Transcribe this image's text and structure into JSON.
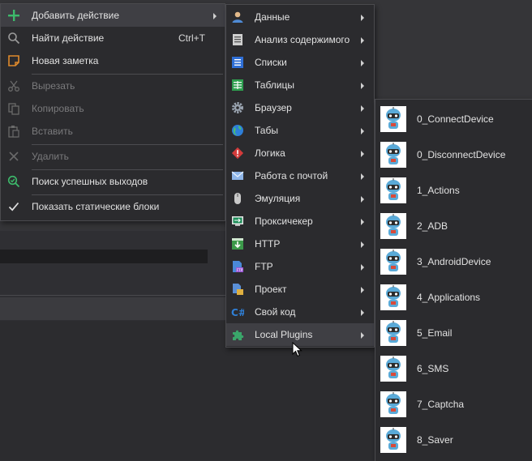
{
  "context_menu": {
    "items": [
      {
        "label": "Добавить действие",
        "icon": "plus-icon",
        "submenu": true,
        "highlighted": true
      },
      {
        "label": "Найти действие",
        "icon": "search-icon",
        "shortcut": "Ctrl+T"
      },
      {
        "label": "Новая заметка",
        "icon": "note-icon"
      },
      {
        "label": "Вырезать",
        "icon": "scissors-icon",
        "disabled": true
      },
      {
        "label": "Копировать",
        "icon": "copy-icon",
        "disabled": true
      },
      {
        "label": "Вставить",
        "icon": "paste-icon",
        "disabled": true
      },
      {
        "label": "Удалить",
        "icon": "delete-icon",
        "disabled": true
      },
      {
        "label": "Поиск успешных выходов",
        "icon": "search-success-icon"
      },
      {
        "label": "Показать статические блоки",
        "icon": "checkmark-icon"
      }
    ]
  },
  "actions_submenu": {
    "items": [
      {
        "label": "Данные",
        "icon": "user-data-icon"
      },
      {
        "label": "Анализ содержимого",
        "icon": "document-analysis-icon"
      },
      {
        "label": "Списки",
        "icon": "list-icon"
      },
      {
        "label": "Таблицы",
        "icon": "table-icon"
      },
      {
        "label": "Браузер",
        "icon": "browser-gear-icon"
      },
      {
        "label": "Табы",
        "icon": "globe-icon"
      },
      {
        "label": "Логика",
        "icon": "logic-icon"
      },
      {
        "label": "Работа с почтой",
        "icon": "mail-icon"
      },
      {
        "label": "Эмуляция",
        "icon": "mouse-icon"
      },
      {
        "label": "Проксичекер",
        "icon": "proxy-checker-icon"
      },
      {
        "label": "HTTP",
        "icon": "http-download-icon"
      },
      {
        "label": "FTP",
        "icon": "ftp-icon"
      },
      {
        "label": "Проект",
        "icon": "project-icon"
      },
      {
        "label": "Свой код",
        "icon": "csharp-icon"
      },
      {
        "label": "Local Plugins",
        "icon": "puzzle-icon",
        "highlighted": true
      }
    ]
  },
  "plugins_submenu": {
    "items": [
      {
        "label": "0_ConnectDevice",
        "icon": "robot-icon"
      },
      {
        "label": "0_DisconnectDevice",
        "icon": "robot-icon"
      },
      {
        "label": "1_Actions",
        "icon": "robot-icon"
      },
      {
        "label": "2_ADB",
        "icon": "robot-icon"
      },
      {
        "label": "3_AndroidDevice",
        "icon": "robot-icon"
      },
      {
        "label": "4_Applications",
        "icon": "robot-icon"
      },
      {
        "label": "5_Email",
        "icon": "robot-icon"
      },
      {
        "label": "6_SMS",
        "icon": "robot-icon"
      },
      {
        "label": "7_Captcha",
        "icon": "robot-icon"
      },
      {
        "label": "8_Saver",
        "icon": "robot-icon"
      }
    ]
  },
  "colors": {
    "menu_bg": "#2b2b2e",
    "highlight": "#3f3f44",
    "disabled_text": "#7a7a7c",
    "accent_green": "#3dba6b"
  }
}
